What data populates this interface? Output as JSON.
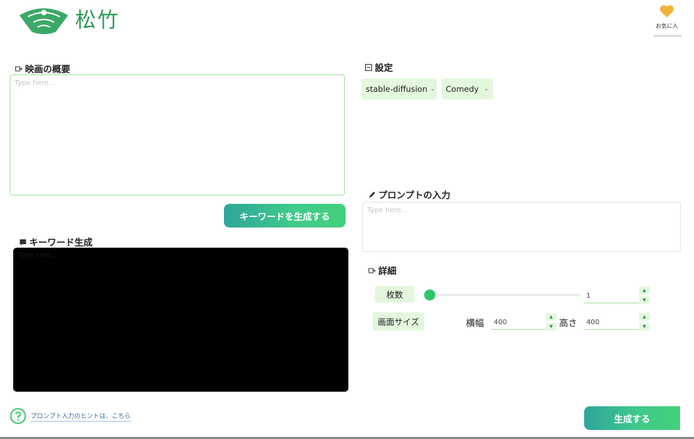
{
  "app": {
    "title": "松竹",
    "favorites_label": "お気に入"
  },
  "overview": {
    "title": "映画の概要",
    "placeholder": "Type here..."
  },
  "keyword_button": {
    "label": "キーワードを生成する"
  },
  "keywords": {
    "title": "キーワード生成",
    "placeholder": "Type here..."
  },
  "help": {
    "link_text": "プロンプト入力のヒントは、こちら"
  },
  "settings": {
    "title": "設定",
    "model_selected": "stable-diffusion",
    "genre_selected": "Comedy"
  },
  "prompt": {
    "title": "プロンプトの入力",
    "placeholder": "Type here..."
  },
  "details": {
    "title": "詳細",
    "count_label": "枚数",
    "count_value": "1",
    "size_label": "画面サイズ",
    "width_label": "横幅",
    "width_value": "400",
    "height_label": "高さ",
    "height_value": "400"
  },
  "generate_button": {
    "label": "生成する"
  },
  "icons": {
    "logo": "pine-fan-logo-icon",
    "favorite": "heart-icon",
    "help": "question-circle-icon",
    "overview": "video-icon",
    "keywords": "chat-icon",
    "settings": "settings-box-icon",
    "prompt": "pencil-icon",
    "details": "video-icon"
  },
  "colors": {
    "brand_green": "#2f9a5b",
    "accent_light_green": "#e3f7dd",
    "heart": "#f2b33d",
    "button_gradient_start": "#2fa59a",
    "button_gradient_end": "#44d07a"
  }
}
